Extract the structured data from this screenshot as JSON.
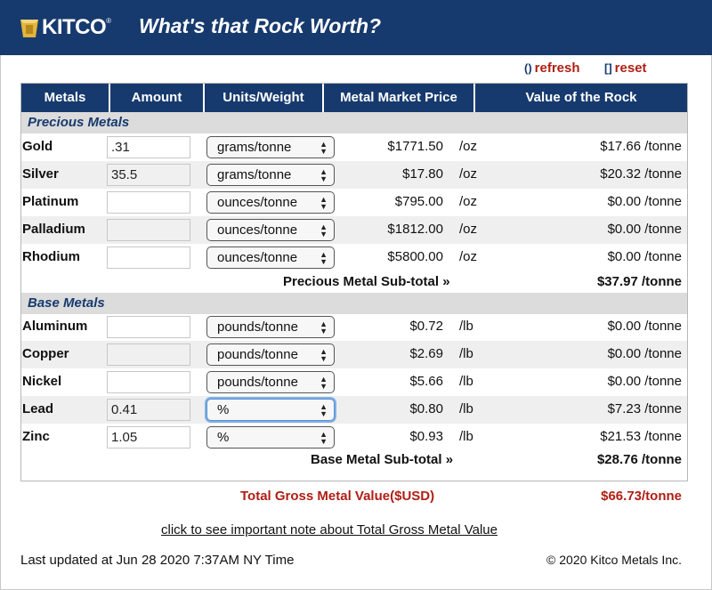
{
  "header": {
    "logo_text": "KITCO",
    "logo_reg": "®",
    "title": "What's that Rock Worth?"
  },
  "actions": {
    "refresh_icon": "refresh-arrows-icon",
    "refresh_label": "refresh",
    "reset_icon": "reset-brackets-icon",
    "reset_label": "reset"
  },
  "columns": [
    "Metals",
    "Amount",
    "Units/Weight",
    "Metal Market Price",
    "Value of the Rock"
  ],
  "precious": {
    "title": "Precious Metals",
    "rows": [
      {
        "metal": "Gold",
        "amount": ".31",
        "unit": "grams/tonne",
        "price": "$1771.50",
        "per": "/oz",
        "value": "$17.66 /tonne"
      },
      {
        "metal": "Silver",
        "amount": "35.5",
        "unit": "grams/tonne",
        "price": "$17.80",
        "per": "/oz",
        "value": "$20.32 /tonne"
      },
      {
        "metal": "Platinum",
        "amount": "",
        "unit": "ounces/tonne",
        "price": "$795.00",
        "per": "/oz",
        "value": "$0.00 /tonne"
      },
      {
        "metal": "Palladium",
        "amount": "",
        "unit": "ounces/tonne",
        "price": "$1812.00",
        "per": "/oz",
        "value": "$0.00 /tonne"
      },
      {
        "metal": "Rhodium",
        "amount": "",
        "unit": "ounces/tonne",
        "price": "$5800.00",
        "per": "/oz",
        "value": "$0.00 /tonne"
      }
    ],
    "subtotal_label": "Precious Metal Sub-total »",
    "subtotal_value": "$37.97 /tonne"
  },
  "base": {
    "title": "Base Metals",
    "rows": [
      {
        "metal": "Aluminum",
        "amount": "",
        "unit": "pounds/tonne",
        "price": "$0.72",
        "per": "/lb",
        "value": "$0.00 /tonne"
      },
      {
        "metal": "Copper",
        "amount": "",
        "unit": "pounds/tonne",
        "price": "$2.69",
        "per": "/lb",
        "value": "$0.00 /tonne"
      },
      {
        "metal": "Nickel",
        "amount": "",
        "unit": "pounds/tonne",
        "price": "$5.66",
        "per": "/lb",
        "value": "$0.00 /tonne"
      },
      {
        "metal": "Lead",
        "amount": "0.41",
        "unit": "%",
        "price": "$0.80",
        "per": "/lb",
        "value": "$7.23 /tonne"
      },
      {
        "metal": "Zinc",
        "amount": "1.05",
        "unit": "%",
        "price": "$0.93",
        "per": "/lb",
        "value": "$21.53 /tonne"
      }
    ],
    "subtotal_label": "Base Metal Sub-total »",
    "subtotal_value": "$28.76 /tonne"
  },
  "gross": {
    "label": "Total Gross Metal Value($USD)",
    "value": "$66.73/tonne"
  },
  "note_link": "click to see important note about Total Gross Metal Value",
  "updated": "Last updated at Jun 28 2020 7:37AM NY Time",
  "copyright": "© 2020 Kitco Metals Inc.",
  "colors": {
    "brand_navy": "#173a6e",
    "accent_red": "#b01e14",
    "logo_gold": "#e2b53c"
  }
}
